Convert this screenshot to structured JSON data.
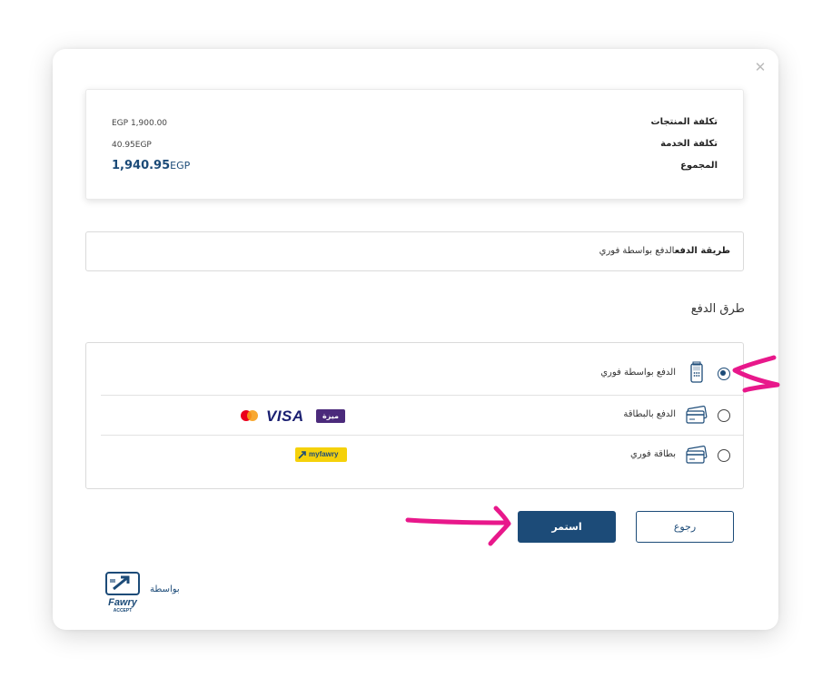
{
  "summary": {
    "products_label": "تكلفة المنتجات",
    "products_value": "EGP 1,900.00",
    "service_label": "تكلفة الخدمة",
    "service_value": "40.95EGP",
    "total_label": "المجموع",
    "total_amount": "1,940.95",
    "total_currency": "EGP"
  },
  "method_bar": {
    "label": "طريقة الدفع",
    "value": "الدفع بواسطة فوري"
  },
  "payment_methods": {
    "title": "طرق الدفع",
    "options": [
      {
        "label": "الدفع بواسطة فوري",
        "icon": "pos-terminal-icon",
        "selected": true
      },
      {
        "label": "الدفع بالبطاقة",
        "icon": "credit-card-icon",
        "selected": false
      },
      {
        "label": "بطاقة فوري",
        "icon": "credit-card-icon",
        "selected": false
      }
    ],
    "card_brands": {
      "visa": "VISA",
      "meeza": "ميزة",
      "mastercard": "mastercard-logo"
    },
    "myfawry": "myfawry"
  },
  "buttons": {
    "continue": "استمر",
    "back": "رجوع"
  },
  "footer": {
    "powered_by": "بواسطة",
    "logo": "fawry-accept-logo"
  },
  "colors": {
    "primary": "#1c4b78",
    "annotation": "#e8188b"
  }
}
